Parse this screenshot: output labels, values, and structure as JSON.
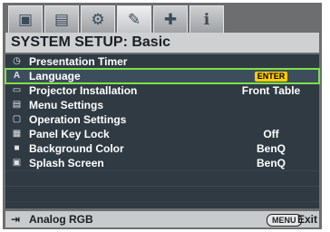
{
  "title": "SYSTEM SETUP: Basic",
  "tabs": [
    {
      "icon": "picture-icon",
      "glyph": "▣"
    },
    {
      "icon": "display-icon",
      "glyph": "▤"
    },
    {
      "icon": "settings-icon",
      "glyph": "⚙"
    },
    {
      "icon": "wrench-icon",
      "glyph": "✎"
    },
    {
      "icon": "advanced-icon",
      "glyph": "✚"
    },
    {
      "icon": "info-icon",
      "glyph": "ℹ"
    }
  ],
  "menu_items": [
    {
      "label": "Presentation Timer",
      "value": "",
      "icon": "timer-icon",
      "glyph": "◷"
    },
    {
      "label": "Language",
      "value": "ENTER",
      "icon": "language-icon",
      "glyph": "A"
    },
    {
      "label": "Projector Installation",
      "value": "Front Table",
      "icon": "projector-icon",
      "glyph": "▭"
    },
    {
      "label": "Menu Settings",
      "value": "",
      "icon": "menu-settings-icon",
      "glyph": "▤"
    },
    {
      "label": "Operation Settings",
      "value": "",
      "icon": "operation-settings-icon",
      "glyph": "▢"
    },
    {
      "label": "Panel Key Lock",
      "value": "Off",
      "icon": "key-lock-icon",
      "glyph": "▦"
    },
    {
      "label": "Background Color",
      "value": "BenQ",
      "icon": "background-color-icon",
      "glyph": "■"
    },
    {
      "label": "Splash Screen",
      "value": "BenQ",
      "icon": "splash-screen-icon",
      "glyph": "▣"
    }
  ],
  "selected_index": 1,
  "footer": {
    "source": "Analog RGB",
    "menu_key": "MENU",
    "exit_label": "Exit"
  }
}
